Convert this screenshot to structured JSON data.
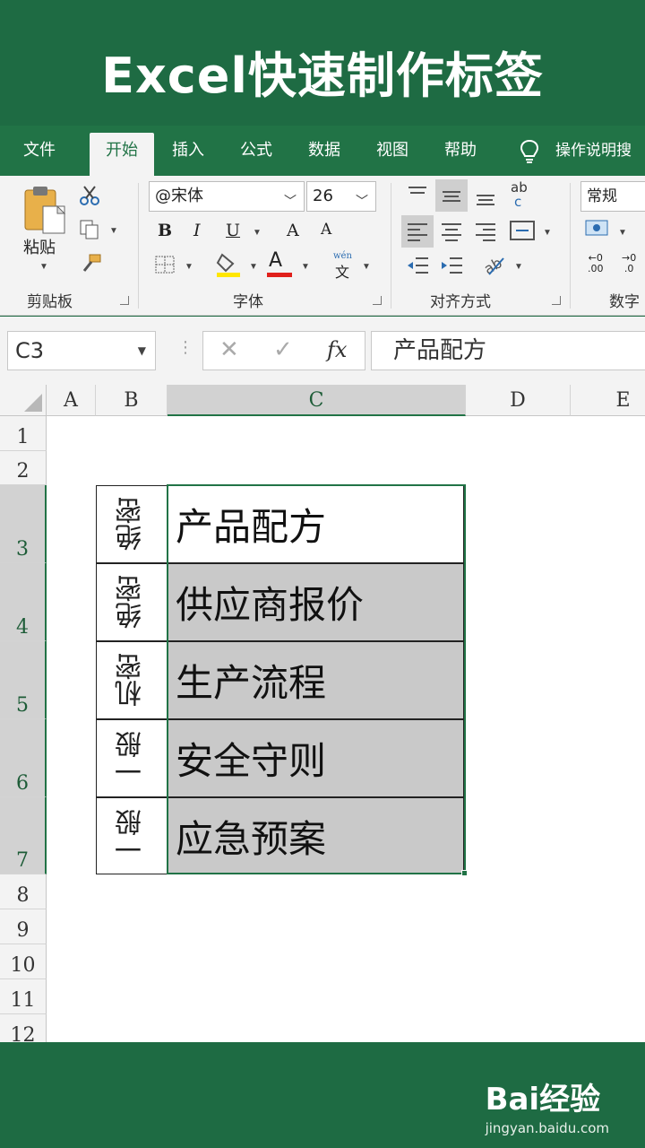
{
  "banner": {
    "title": "Excel快速制作标签"
  },
  "tabs": [
    {
      "label": "文件"
    },
    {
      "label": "开始"
    },
    {
      "label": "插入"
    },
    {
      "label": "公式"
    },
    {
      "label": "数据"
    },
    {
      "label": "视图"
    },
    {
      "label": "帮助"
    },
    {
      "label": "操作说明搜"
    }
  ],
  "ribbon": {
    "clipboard": {
      "paste_label": "粘贴",
      "group_label": "剪贴板"
    },
    "font": {
      "font_name": "@宋体",
      "font_size": "26",
      "bold": "B",
      "italic": "I",
      "underline": "U",
      "grow": "A",
      "shrink": "A",
      "font_color": "A",
      "phonetic_top": "wén",
      "phonetic_bottom": "文",
      "group_label": "字体"
    },
    "alignment": {
      "wrap_top": "ab",
      "wrap_bottom": "c",
      "group_label": "对齐方式"
    },
    "number": {
      "format": "常规",
      "dec_inc": ".00",
      "dec_dec": ".0",
      "dec_inc_small": "←0",
      "dec_dec_small": "→0",
      "group_label": "数字"
    }
  },
  "formula_bar": {
    "name_box": "C3",
    "cancel": "✕",
    "enter": "✓",
    "fx": "fx",
    "content": "产品配方"
  },
  "sheet": {
    "columns": [
      "A",
      "B",
      "C",
      "D",
      "E"
    ],
    "rows": [
      "1",
      "2",
      "3",
      "4",
      "5",
      "6",
      "7",
      "8",
      "9",
      "10",
      "11",
      "12"
    ],
    "labels": [
      {
        "tag": "绝密",
        "name": "产品配方"
      },
      {
        "tag": "绝密",
        "name": "供应商报价"
      },
      {
        "tag": "机密",
        "name": "生产流程"
      },
      {
        "tag": "一般",
        "name": "安全守则"
      },
      {
        "tag": "一般",
        "name": "应急预案"
      }
    ]
  },
  "watermark": {
    "logo": "Bai经验",
    "url": "jingyan.baidu.com"
  },
  "colors": {
    "excel_green": "#217346",
    "banner_green": "#1e6b43",
    "selection_gray": "#c9c9c9"
  }
}
